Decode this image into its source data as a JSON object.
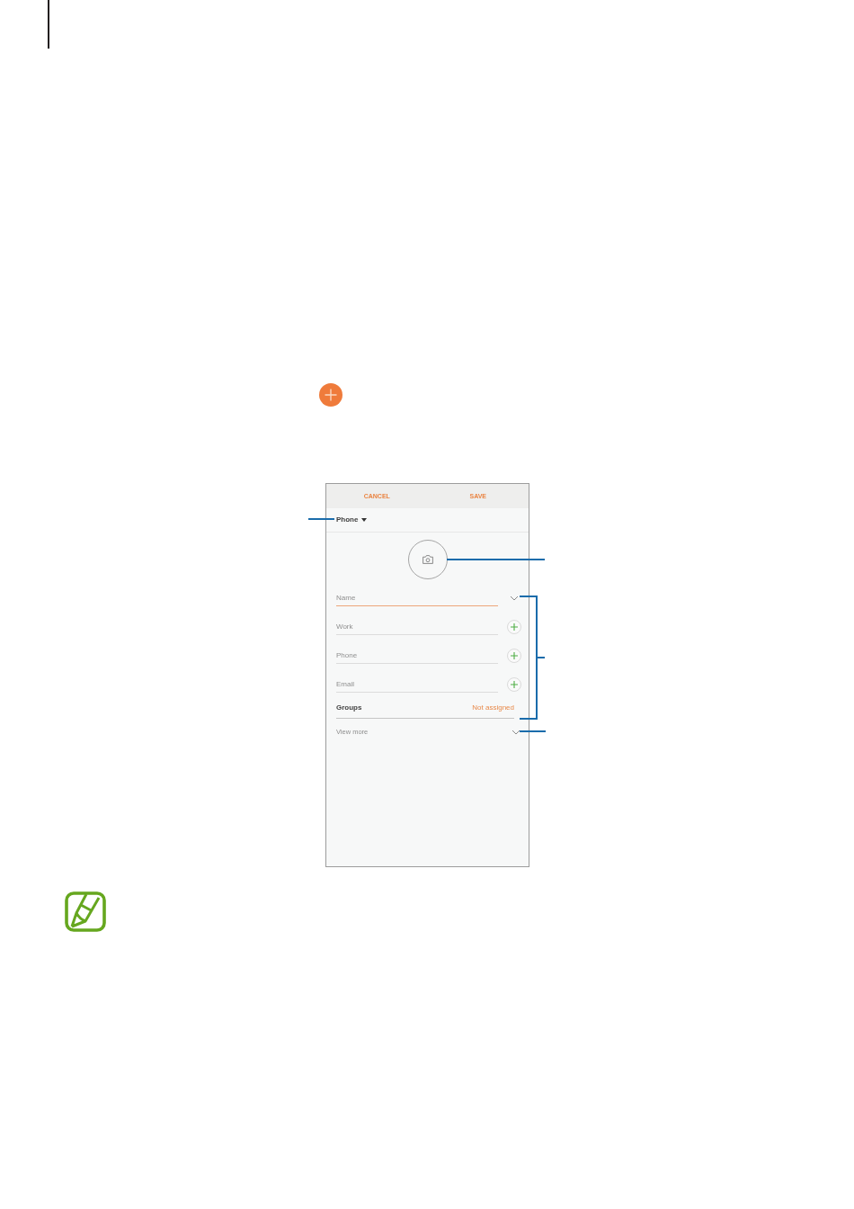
{
  "screen": {
    "app_bar": {
      "buttons": [
        "CANCEL",
        "SAVE"
      ]
    },
    "storage": {
      "label": "Phone"
    },
    "fields": [
      {
        "kind": "expand",
        "placeholder": "Name",
        "focused": true
      },
      {
        "kind": "add",
        "placeholder": "Work",
        "focused": false
      },
      {
        "kind": "add",
        "placeholder": "Phone",
        "focused": false
      },
      {
        "kind": "add",
        "placeholder": "Email",
        "focused": false
      }
    ],
    "groups": {
      "label": "Groups",
      "value": "Not assigned"
    },
    "view_more": {
      "label": "View more"
    }
  }
}
